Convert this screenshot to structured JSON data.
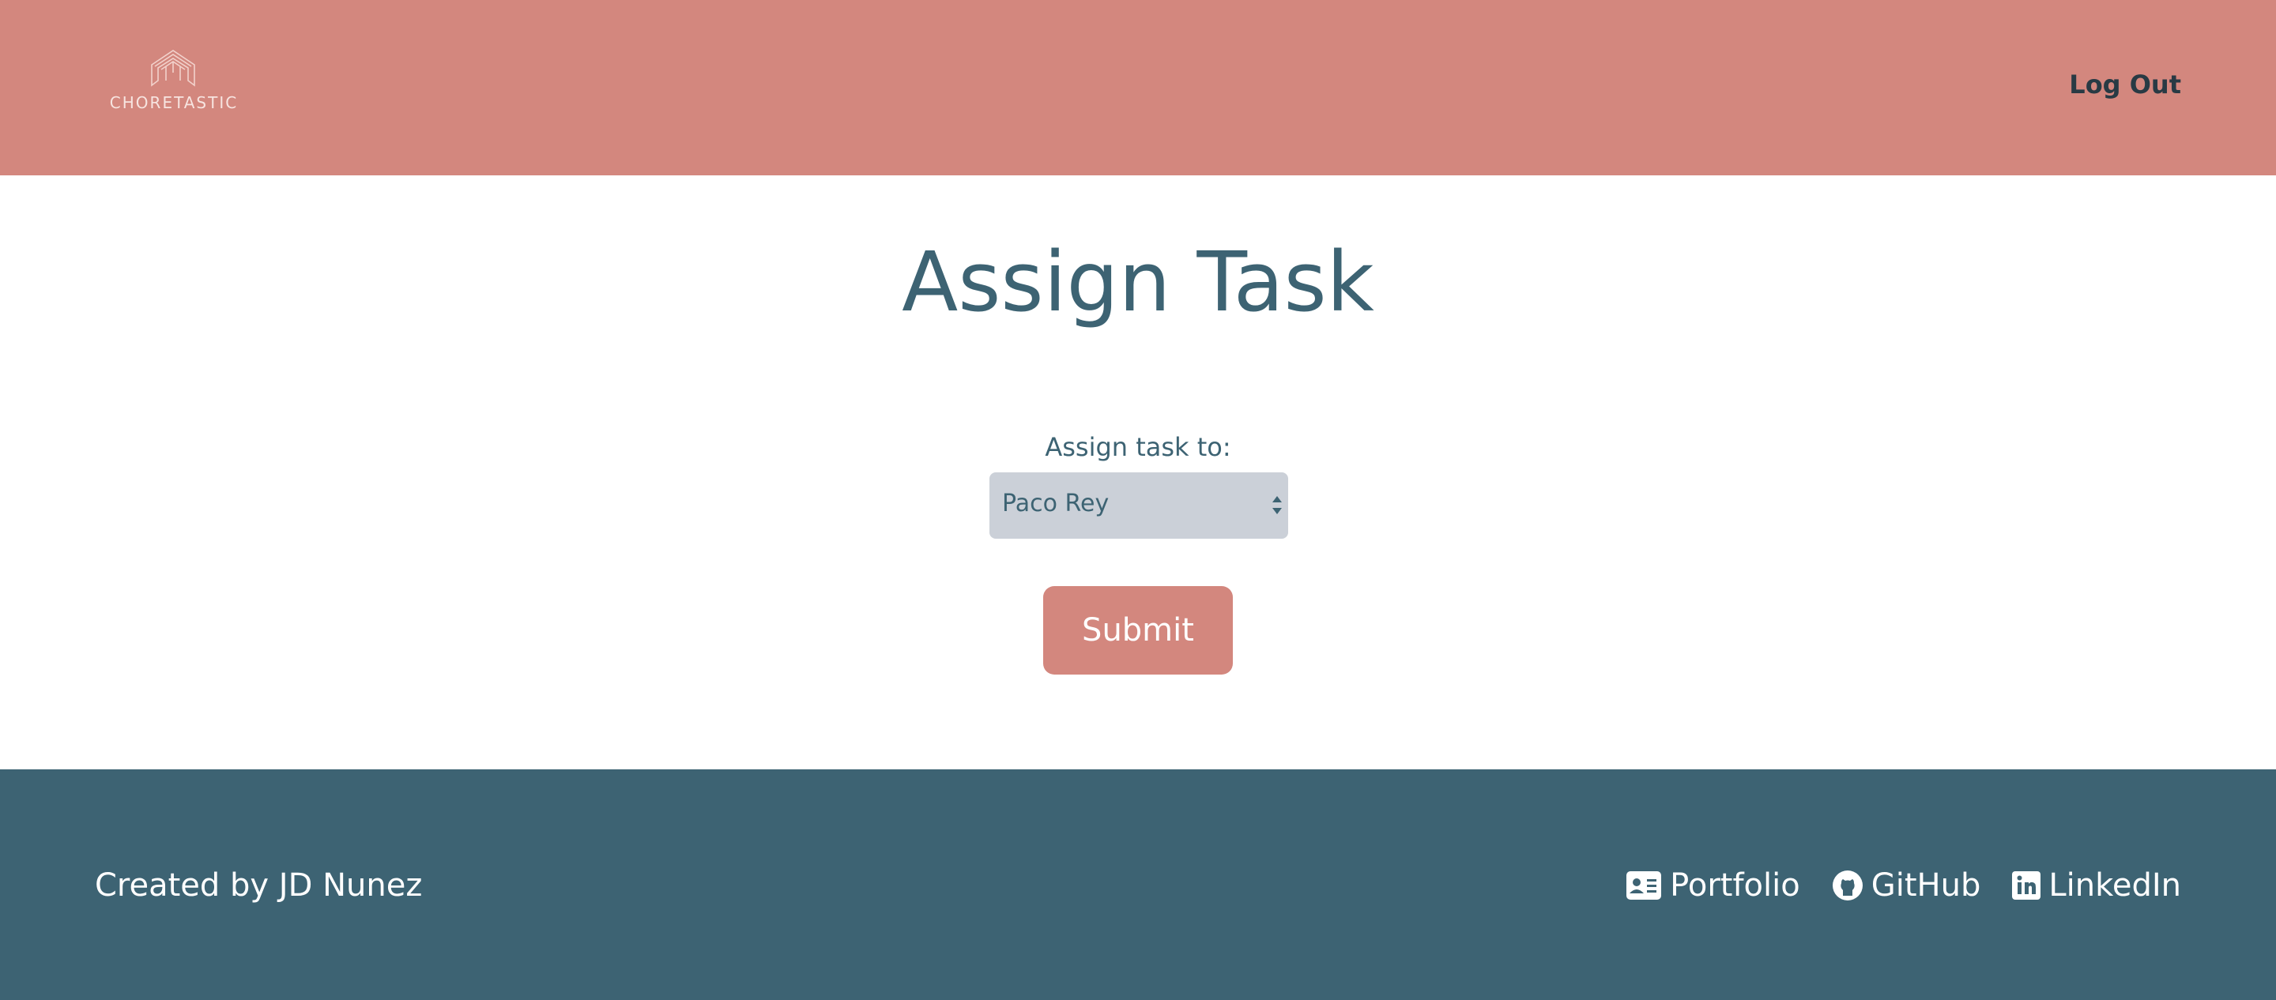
{
  "header": {
    "logo_text": "CHORETASTIC",
    "logout_label": "Log Out"
  },
  "main": {
    "title": "Assign Task",
    "assign_label": "Assign task to:",
    "select_value": "Paco Rey",
    "submit_label": "Submit"
  },
  "footer": {
    "credit": "Created by JD Nunez",
    "links": [
      {
        "label": "Portfolio",
        "icon": "id-card-icon"
      },
      {
        "label": "GitHub",
        "icon": "github-icon"
      },
      {
        "label": "LinkedIn",
        "icon": "linkedin-icon"
      }
    ]
  },
  "colors": {
    "header_bg": "#d3877e",
    "footer_bg": "#3d6373",
    "title_text": "#3d6373",
    "select_bg": "#cbd0d8",
    "button_bg": "#d3877e"
  }
}
